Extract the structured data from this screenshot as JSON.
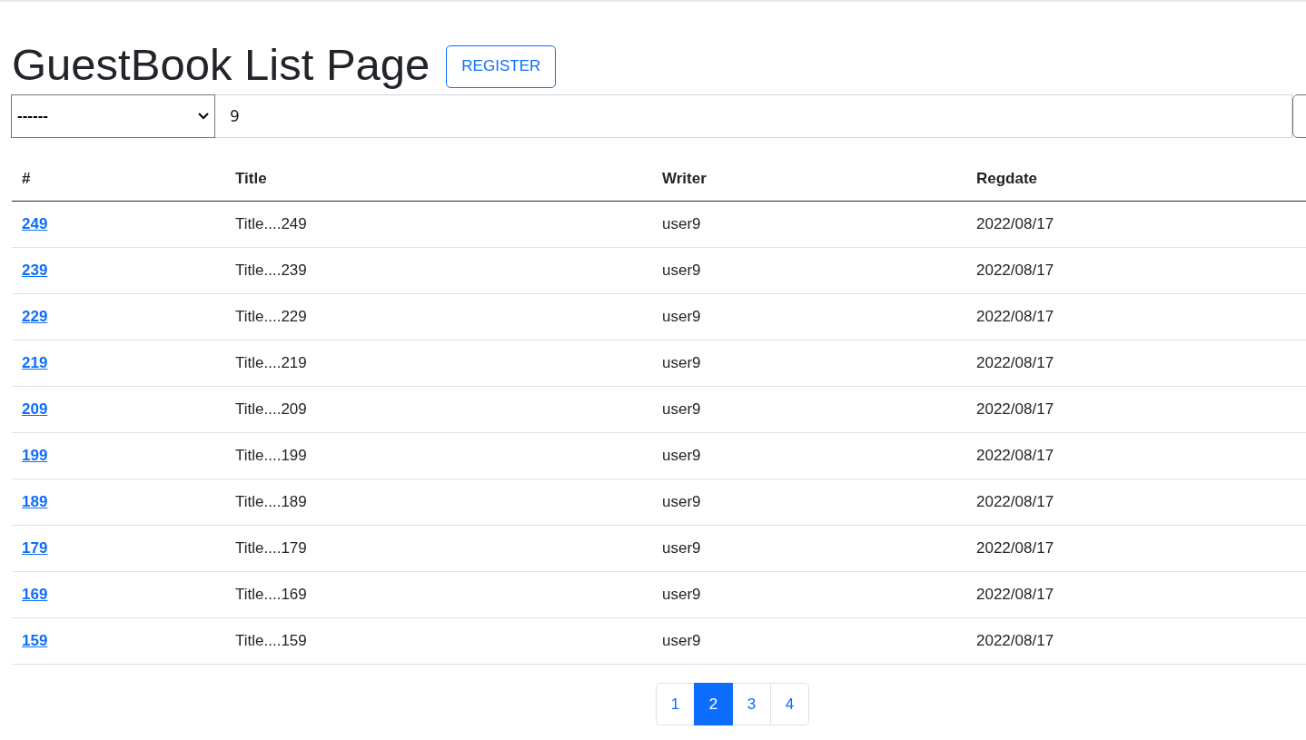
{
  "heading": "GuestBook List Page",
  "register_button": "REGISTER",
  "search": {
    "type_select": "------",
    "keyword": "9"
  },
  "table": {
    "columns": [
      "#",
      "Title",
      "Writer",
      "Regdate"
    ],
    "rows": [
      {
        "number": "249",
        "title": "Title....249",
        "writer": "user9",
        "regdate": "2022/08/17"
      },
      {
        "number": "239",
        "title": "Title....239",
        "writer": "user9",
        "regdate": "2022/08/17"
      },
      {
        "number": "229",
        "title": "Title....229",
        "writer": "user9",
        "regdate": "2022/08/17"
      },
      {
        "number": "219",
        "title": "Title....219",
        "writer": "user9",
        "regdate": "2022/08/17"
      },
      {
        "number": "209",
        "title": "Title....209",
        "writer": "user9",
        "regdate": "2022/08/17"
      },
      {
        "number": "199",
        "title": "Title....199",
        "writer": "user9",
        "regdate": "2022/08/17"
      },
      {
        "number": "189",
        "title": "Title....189",
        "writer": "user9",
        "regdate": "2022/08/17"
      },
      {
        "number": "179",
        "title": "Title....179",
        "writer": "user9",
        "regdate": "2022/08/17"
      },
      {
        "number": "169",
        "title": "Title....169",
        "writer": "user9",
        "regdate": "2022/08/17"
      },
      {
        "number": "159",
        "title": "Title....159",
        "writer": "user9",
        "regdate": "2022/08/17"
      }
    ]
  },
  "pagination": [
    {
      "label": "1",
      "selected": false
    },
    {
      "label": "2",
      "selected": true
    },
    {
      "label": "3",
      "selected": false
    },
    {
      "label": "4",
      "selected": false
    }
  ]
}
